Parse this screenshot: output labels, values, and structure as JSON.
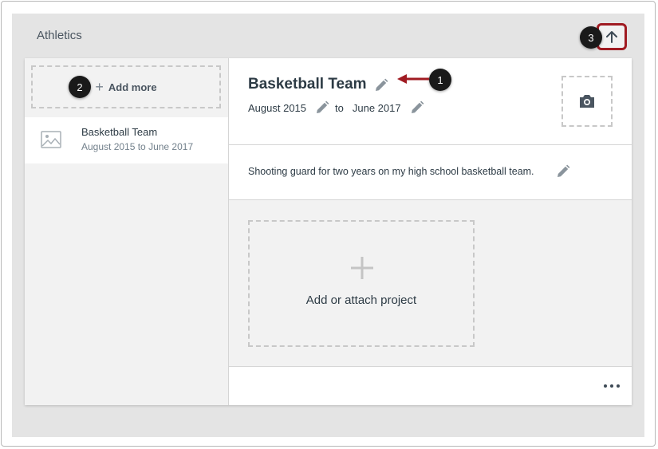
{
  "section": {
    "title": "Athletics"
  },
  "sidebar": {
    "add_more_label": "Add more",
    "entries": [
      {
        "title": "Basketball Team",
        "dates": "August 2015 to June 2017"
      }
    ]
  },
  "detail": {
    "title": "Basketball Team",
    "start_date": "August 2015",
    "to_label": "to",
    "end_date": "June 2017",
    "description": "Shooting guard for two years on my high school basketball team.",
    "add_project_label": "Add or attach project"
  },
  "callouts": [
    "1",
    "2",
    "3"
  ],
  "colors": {
    "accent_border": "#a01b22",
    "callout_bg": "#1a1a1a",
    "section_bg": "#e4e4e4"
  },
  "icons": {
    "move_up": "arrow-up-icon",
    "edit": "pencil-icon",
    "add": "plus-icon",
    "image": "image-placeholder-icon",
    "camera": "camera-icon",
    "more": "more-options-icon"
  }
}
